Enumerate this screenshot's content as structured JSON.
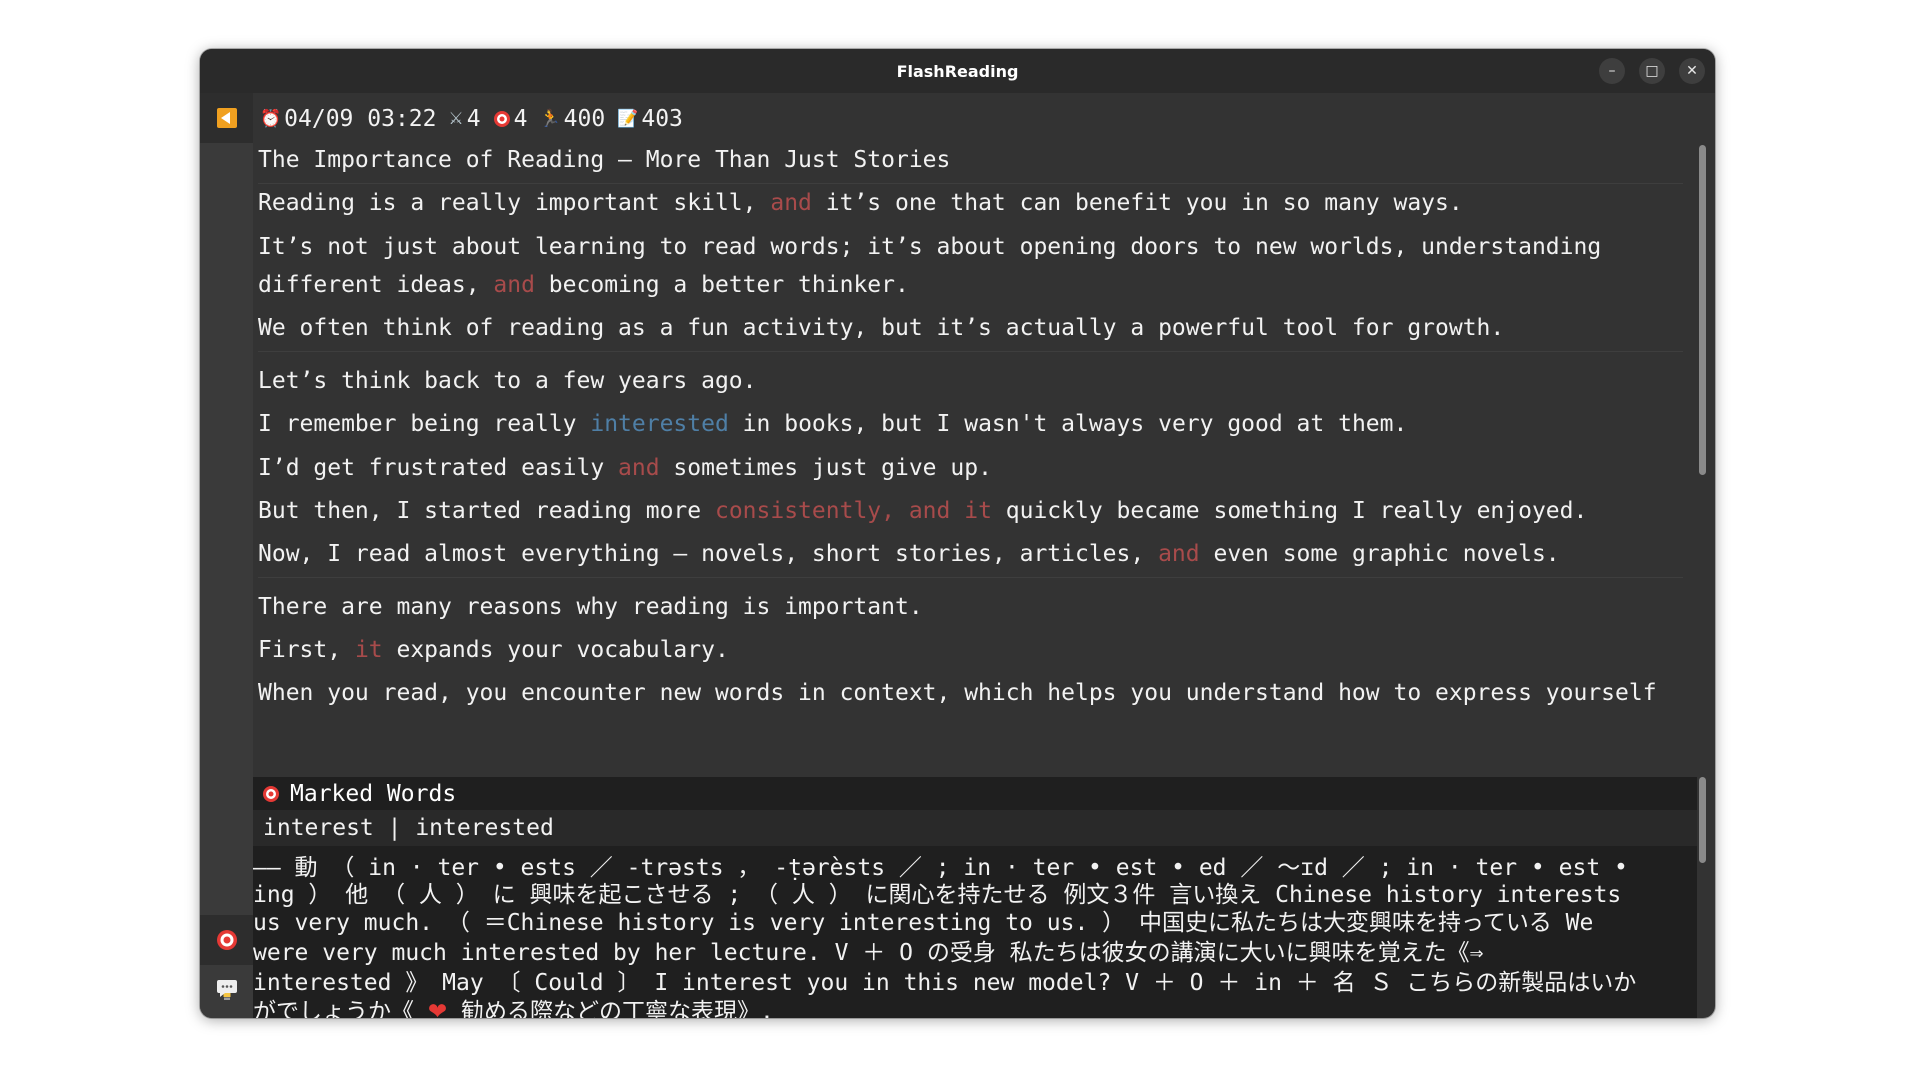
{
  "window": {
    "title": "FlashReading"
  },
  "controls": {
    "minimize": "–",
    "maximize": "□",
    "close": "✕"
  },
  "stats": {
    "datetime": "04/09 03:22",
    "swords": "4",
    "target": "4",
    "speed": "400",
    "notes": "403",
    "icons": [
      "alarm-clock-icon",
      "crossed-swords-icon",
      "target-icon",
      "running-icon",
      "memo-icon"
    ]
  },
  "doc": {
    "title": "The Importance of Reading – More Than Just Stories",
    "lines": {
      "l1a": "Reading is a really important skill, ",
      "l1b": "and",
      "l1c": " it’s one that can benefit you in so many ways.",
      "l2": "It’s not just about learning to read words; it’s about opening doors to new worlds, understanding",
      "l3a": "different ideas, ",
      "l3b": "and",
      "l3c": " becoming a better thinker.",
      "l4": "We often think of reading as a fun activity, but it’s actually a powerful tool for growth.",
      "l5": "Let’s think back to a few years ago.",
      "l6a": "I remember being really ",
      "l6b": "interested",
      "l6c": " in books, but I wasn't always very good at them.",
      "l7a": "I’d get frustrated easily ",
      "l7b": "and",
      "l7c": " sometimes just give up.",
      "l8a": "But then, I started reading more ",
      "l8b": "consistently, and it",
      "l8c": " quickly became something I really enjoyed.",
      "l9a": "Now, I read almost everything – novels, short stories, articles, ",
      "l9b": "and",
      "l9c": " even some graphic novels.",
      "l10": "There are many reasons why reading is important.",
      "l11a": "First, ",
      "l11b": "it",
      "l11c": " expands your vocabulary.",
      "l12": "When you read, you encounter new words in context, which helps you understand how to express yourself"
    }
  },
  "marked": {
    "header": "Marked Words",
    "word": "interest | interested"
  },
  "definition": {
    "d1": "—— 動 （ in · ter • ests ／ -trəsts ， -ṭərèsts ／ ; in · ter • est • ed ／ ～ɪd ／ ; in · ter • est •",
    "d2": "ing ） 他 （ 人 ） に 興味を起こさせる ; （ 人 ） に関心を持たせる 例文３件 言い換え Chinese history interests",
    "d3": "us very much. （ ＝Chinese history is very interesting to us. ） 中国史に私たちは大変興味を持っている We",
    "d4": "were very much interested by her lecture. V ＋ O  の受身 私たちは彼女の講演に大いに興味を覚えた《⇒",
    "d5": "interested 》 May 〔 Could 〕 I interest you in this new model? V ＋ O ＋ in ＋ 名  Ｓ こちらの新製品はいか",
    "d6a": "がでしょうか《 ",
    "d6b": "❤",
    "d6c": " 勧める際などの丁寧な表現》."
  },
  "colors": {
    "highlight_red": "#a84b4b",
    "highlight_blue": "#4f7fa6",
    "background": "#333333"
  }
}
